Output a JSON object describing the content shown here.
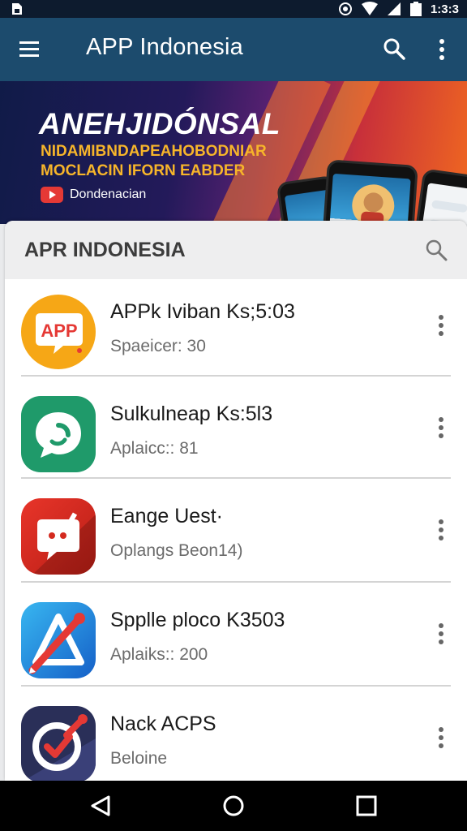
{
  "status_bar": {
    "time": "1:3:3",
    "icons": [
      "sim-card-icon",
      "alarm-icon",
      "wifi-icon",
      "signal-icon",
      "battery-icon"
    ]
  },
  "app_bar": {
    "title": "APP Indonesia",
    "menu_icon": "hamburger-menu-icon",
    "search_icon": "search-icon",
    "more_icon": "more-vertical-icon",
    "background": "#1c4b6d"
  },
  "banner": {
    "headline": "ANEHJIDÓNSAL",
    "subline1": "NIDAMIBNDAPEAHOBODNIAR",
    "subline2": "MOCLACIN IFORN EABDER",
    "channel_label": "Dondenacian",
    "accent": "#f7b52a"
  },
  "section": {
    "heading": "APR INDONESIA",
    "search_icon": "search-icon"
  },
  "apps": [
    {
      "name": "APPk Iviban Ks;5:03",
      "meta": "Spaeicer: 30",
      "icon": "app-speech-bubble-icon",
      "color": "#f6a716"
    },
    {
      "name": "Sulkulneap Ks:5l3",
      "meta": "Aplaicc:: 81",
      "icon": "chat-bubble-icon",
      "color": "#1f9a6a"
    },
    {
      "name": "Eange Uest·",
      "meta": "Oplangs Beon14)",
      "icon": "game-controller-bubble-icon",
      "color": "#d42a1f"
    },
    {
      "name": "Spplle ploco K3503",
      "meta": "Aplaiks:: 200",
      "icon": "drawing-tool-icon",
      "color": "#1fa3e0"
    },
    {
      "name": "Nack ACPS",
      "meta": "Beloine",
      "icon": "target-icon",
      "color": "#2a2f58"
    }
  ],
  "nav": {
    "back": "back-triangle-icon",
    "home": "home-circle-icon",
    "recents": "recents-square-icon"
  }
}
